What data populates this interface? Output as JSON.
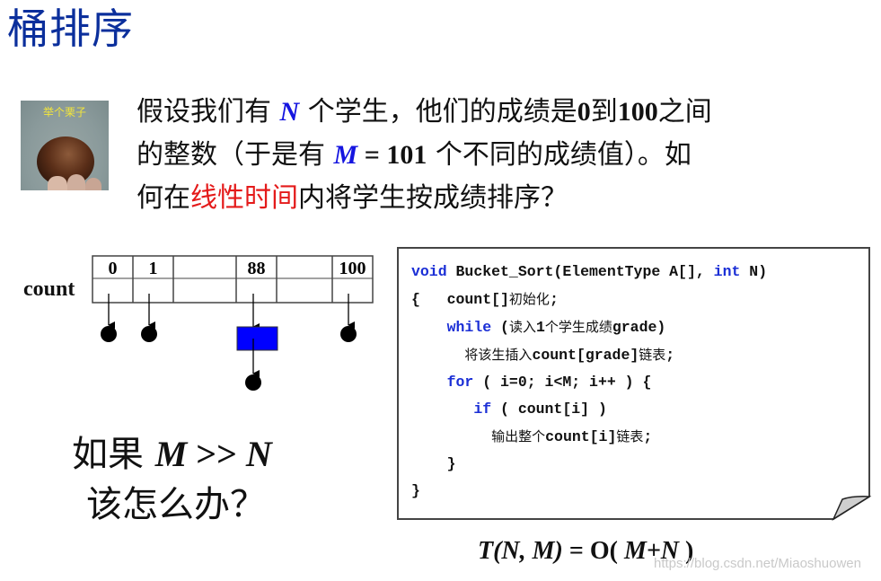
{
  "title": "桶排序",
  "photo": {
    "caption": "举个栗子",
    "icon": "chestnut-photo"
  },
  "paragraph": {
    "line1": {
      "p1": "假设我们有 ",
      "N": "N",
      "p2": " 个学生，他们的成绩是",
      "zero": "0",
      "p3": "到",
      "hundred": "100",
      "p4": "之间"
    },
    "line2": {
      "p1": "的整数（于是有 ",
      "M": "M",
      "eq": " = 101",
      "p2": " 个不同的成绩值）。如"
    },
    "line3": {
      "p1": "何在",
      "highlight": "线性时间",
      "p2": "内将学生按成绩排序？"
    }
  },
  "diagram": {
    "row_label": "count",
    "headers": [
      "0",
      "1",
      "",
      "88",
      "",
      "100"
    ],
    "colors": {
      "node": "#0000ff",
      "dot": "#000000",
      "grid": "#444444"
    }
  },
  "code": {
    "lines": [
      [
        {
          "t": "void",
          "c": "kw"
        },
        {
          "t": " Bucket_Sort(ElementType A[], "
        },
        {
          "t": "int",
          "c": "kw"
        },
        {
          "t": " N)"
        }
      ],
      [
        {
          "t": "{   count[]"
        },
        {
          "t": "初始化",
          "c": "cn"
        },
        {
          "t": ";"
        }
      ],
      [
        {
          "t": "    "
        },
        {
          "t": "while",
          "c": "kw"
        },
        {
          "t": " ("
        },
        {
          "t": "读入",
          "c": "cn"
        },
        {
          "t": "1"
        },
        {
          "t": "个学生成绩",
          "c": "cn"
        },
        {
          "t": "grade)"
        }
      ],
      [
        {
          "t": "      "
        },
        {
          "t": "将该生插入",
          "c": "cn"
        },
        {
          "t": "count[grade]"
        },
        {
          "t": "链表",
          "c": "cn"
        },
        {
          "t": ";"
        }
      ],
      [
        {
          "t": "    "
        },
        {
          "t": "for",
          "c": "kw"
        },
        {
          "t": " ( i=0; i<M; i++ ) {"
        }
      ],
      [
        {
          "t": "       "
        },
        {
          "t": "if",
          "c": "kw"
        },
        {
          "t": " ( count[i] )"
        }
      ],
      [
        {
          "t": "         "
        },
        {
          "t": "输出整个",
          "c": "cn"
        },
        {
          "t": "count[i]"
        },
        {
          "t": "链表",
          "c": "cn"
        },
        {
          "t": ";"
        }
      ],
      [
        {
          "t": "    }"
        }
      ],
      [
        {
          "t": "}"
        }
      ]
    ]
  },
  "question": {
    "line1_prefix": "如果 ",
    "M": "M",
    "op": " >> ",
    "N": "N",
    "line2": "该怎么办？"
  },
  "formula": {
    "T": "T",
    "args": "(N, M)",
    "eq": " = O( ",
    "body": "M+N",
    "close": " )"
  },
  "watermark": "https://blog.csdn.net/Miaoshuowen"
}
